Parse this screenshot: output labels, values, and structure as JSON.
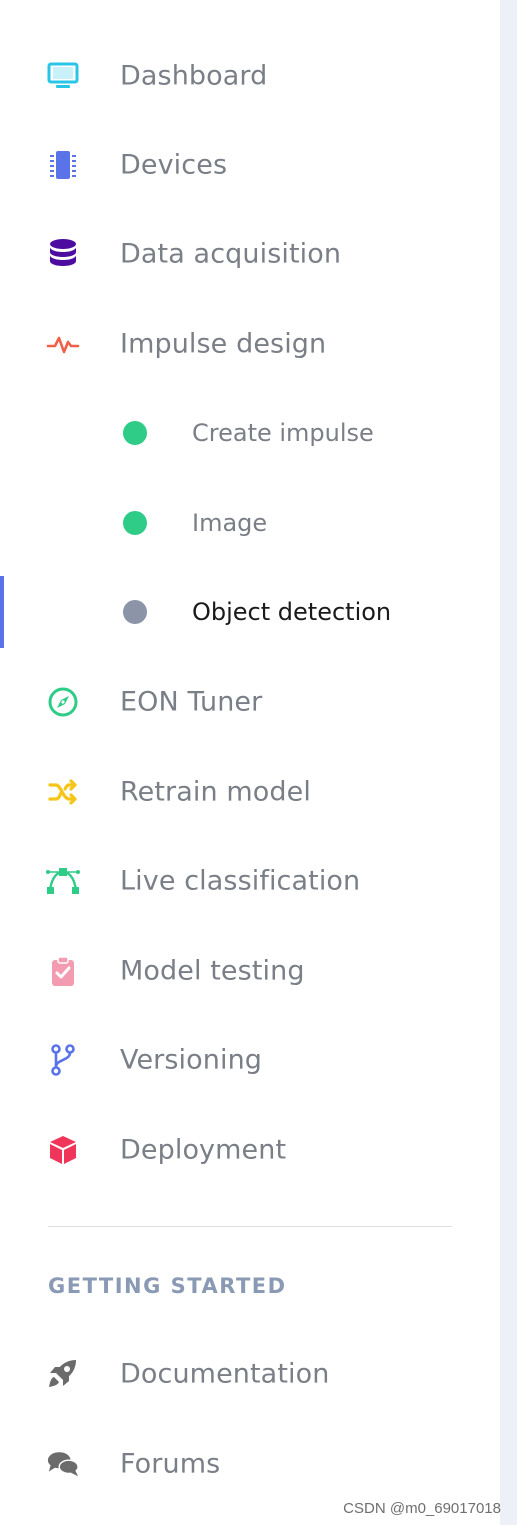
{
  "nav": {
    "items": [
      {
        "label": "Dashboard",
        "icon": "monitor-icon",
        "color": "#29c5e6"
      },
      {
        "label": "Devices",
        "icon": "chip-icon",
        "color": "#5b73e8"
      },
      {
        "label": "Data acquisition",
        "icon": "database-icon",
        "color": "#4b0c9f"
      },
      {
        "label": "Impulse design",
        "icon": "pulse-icon",
        "color": "#f06048"
      }
    ],
    "sub_items": [
      {
        "label": "Create impulse",
        "dot_color": "#2ecc87",
        "active": false
      },
      {
        "label": "Image",
        "dot_color": "#2ecc87",
        "active": false
      },
      {
        "label": "Object detection",
        "dot_color": "#8b95a7",
        "active": true
      }
    ],
    "items_after": [
      {
        "label": "EON Tuner",
        "icon": "compass-icon",
        "color": "#2ecc87"
      },
      {
        "label": "Retrain model",
        "icon": "shuffle-icon",
        "color": "#f5c518"
      },
      {
        "label": "Live classification",
        "icon": "bezier-icon",
        "color": "#2ecc87"
      },
      {
        "label": "Model testing",
        "icon": "clipboard-check-icon",
        "color": "#f39bb0"
      },
      {
        "label": "Versioning",
        "icon": "branch-icon",
        "color": "#5b73e8"
      },
      {
        "label": "Deployment",
        "icon": "cube-icon",
        "color": "#f0355a"
      }
    ]
  },
  "getting_started": {
    "heading": "GETTING STARTED",
    "items": [
      {
        "label": "Documentation",
        "icon": "rocket-icon",
        "color": "#6b6b6b"
      },
      {
        "label": "Forums",
        "icon": "chat-icon",
        "color": "#6b6b6b"
      }
    ]
  },
  "watermark": "CSDN @m0_69017018",
  "colors": {
    "active_bar": "#5b73e8",
    "label_text": "#7a7f87",
    "active_text": "#1a1a1a",
    "section_heading": "#8a99b4",
    "right_strip": "#eef0f8"
  }
}
